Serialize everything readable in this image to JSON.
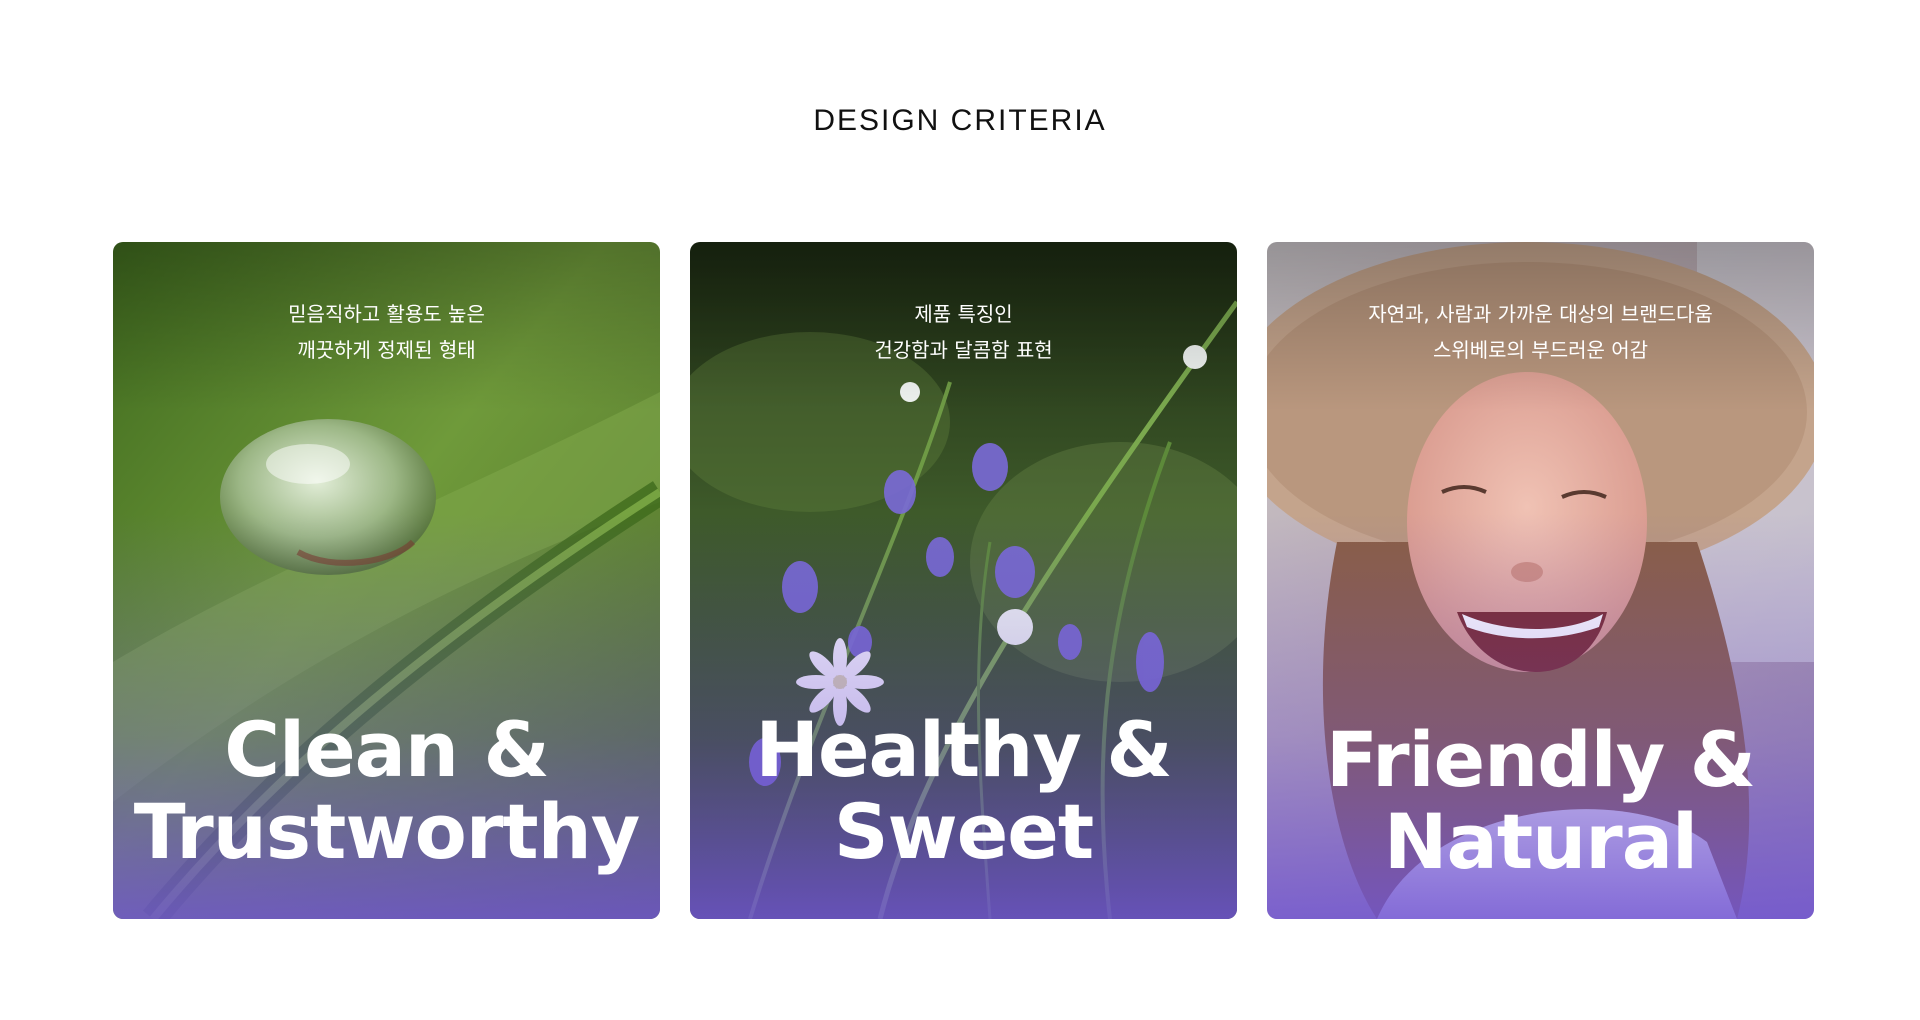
{
  "page": {
    "heading": "DESIGN CRITERIA",
    "overlay_color": "#7054d2"
  },
  "cards": [
    {
      "subtitle_lines": [
        "믿음직하고 활용도 높은",
        "깨끗하게 정제된 형태"
      ],
      "headline_lines": [
        "Clean &",
        "Trustworthy"
      ],
      "image": "water-droplet-on-leaf-photo"
    },
    {
      "subtitle_lines": [
        "제품 특징인",
        "건강함과 달콤함 표현"
      ],
      "headline_lines": [
        "Healthy &",
        "Sweet"
      ],
      "image": "wildflowers-meadow-photo"
    },
    {
      "subtitle_lines": [
        "자연과, 사람과 가까운 대상의 브랜드다움",
        "스위베로의 부드러운 어감"
      ],
      "headline_lines": [
        "Friendly &",
        "Natural"
      ],
      "image": "laughing-woman-in-hat-photo"
    }
  ]
}
